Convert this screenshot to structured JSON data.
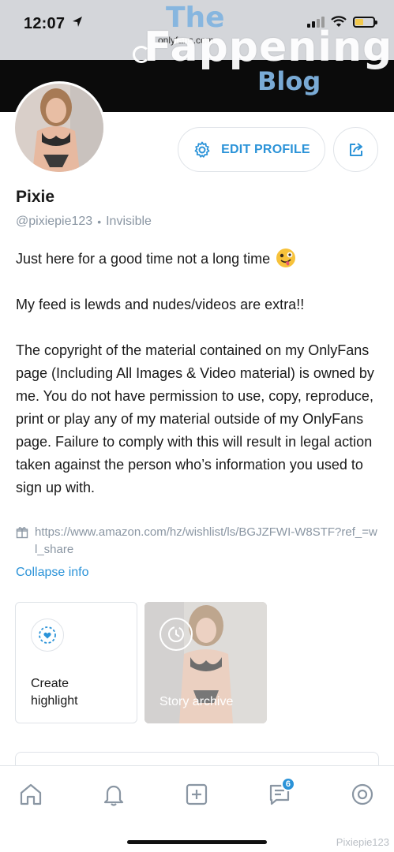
{
  "status_bar": {
    "time": "12:07"
  },
  "browser": {
    "url_fragment": "onlyfans.com"
  },
  "watermark": {
    "line1": "The",
    "line2": "Fappening",
    "line3": "Blog",
    "corner": "Pixiepie123"
  },
  "profile": {
    "name": "Pixie",
    "handle": "@pixiepie123",
    "status": "Invisible",
    "edit_label": "EDIT PROFILE",
    "bio": [
      "Just here for a good time not a long time",
      "My feed is lewds and nudes/videos are extra!!",
      "The copyright of the material contained on my OnlyFans page (Including All Images & Video material) is owned by me. You do not have permission to use, copy, reproduce, print or play any of my material outside of my OnlyFans page. Failure to comply with this will result in legal action taken against the person who’s information you used to sign up with."
    ],
    "wishlist_url": "https://www.amazon.com/hz/wishlist/ls/BGJZFWI-W8STF?ref_=wl_share",
    "collapse_label": "Collapse info"
  },
  "highlights": {
    "create_label": "Create highlight",
    "archive_label": "Story archive"
  },
  "tabbar": {
    "items": [
      {
        "icon": "home-icon"
      },
      {
        "icon": "bell-icon"
      },
      {
        "icon": "add-post-icon"
      },
      {
        "icon": "messages-icon",
        "badge": "6"
      },
      {
        "icon": "profile-icon"
      }
    ]
  },
  "colors": {
    "accent": "#2b93d8",
    "muted": "#8a96a3",
    "border": "#dfe3e8"
  }
}
